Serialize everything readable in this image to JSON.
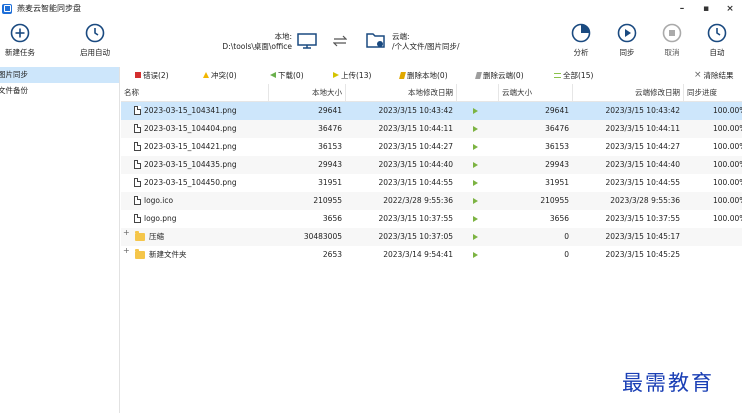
{
  "window": {
    "title": "燕麦云智能同步盘",
    "minimize": "–",
    "maximize": "▪",
    "close": "×"
  },
  "toolbar": {
    "new_task": "新建任务",
    "auto_start": "启用自动",
    "local_label": "本地:",
    "local_path": "D:\\tools\\桌面\\office",
    "cloud_label": "云端:",
    "cloud_path": "/个人文件/图片同步/",
    "analyze": "分析",
    "sync": "同步",
    "cancel": "取消",
    "auto": "自动"
  },
  "sidebar": {
    "items": [
      {
        "label": "图片同步"
      },
      {
        "label": "文件备份"
      }
    ]
  },
  "filters": {
    "error": "错误(2)",
    "conflict": "冲突(0)",
    "download": "下载(0)",
    "upload": "上传(13)",
    "delete_local": "删除本地(0)",
    "delete_cloud": "删除云端(0)",
    "all": "全部(15)",
    "clear": "清除结果",
    "colors": {
      "error": "#d32f2f",
      "conflict": "#f2b600",
      "download": "#6ab04c",
      "upload": "#d4c400",
      "delete_local": "#e0a800",
      "delete_cloud": "#9e9e9e"
    }
  },
  "table": {
    "headers": {
      "name": "名称",
      "local_size": "本地大小",
      "local_modified": "本地修改日期",
      "cloud_size": "云端大小",
      "cloud_modified": "云端修改日期",
      "progress": "同步进度"
    },
    "rows": [
      {
        "type": "file",
        "name": "2023-03-15_104341.png",
        "local_size": "29641",
        "local_modified": "2023/3/15 10:43:42",
        "action": "upload",
        "cloud_size": "29641",
        "cloud_modified": "2023/3/15 10:43:42",
        "progress": "100.00%"
      },
      {
        "type": "file",
        "name": "2023-03-15_104404.png",
        "local_size": "36476",
        "local_modified": "2023/3/15 10:44:11",
        "action": "upload",
        "cloud_size": "36476",
        "cloud_modified": "2023/3/15 10:44:11",
        "progress": "100.00%"
      },
      {
        "type": "file",
        "name": "2023-03-15_104421.png",
        "local_size": "36153",
        "local_modified": "2023/3/15 10:44:27",
        "action": "upload",
        "cloud_size": "36153",
        "cloud_modified": "2023/3/15 10:44:27",
        "progress": "100.00%"
      },
      {
        "type": "file",
        "name": "2023-03-15_104435.png",
        "local_size": "29943",
        "local_modified": "2023/3/15 10:44:40",
        "action": "upload",
        "cloud_size": "29943",
        "cloud_modified": "2023/3/15 10:44:40",
        "progress": "100.00%"
      },
      {
        "type": "file",
        "name": "2023-03-15_104450.png",
        "local_size": "31951",
        "local_modified": "2023/3/15 10:44:55",
        "action": "upload",
        "cloud_size": "31951",
        "cloud_modified": "2023/3/15 10:44:55",
        "progress": "100.00%"
      },
      {
        "type": "file",
        "name": "logo.ico",
        "local_size": "210955",
        "local_modified": "2022/3/28 9:55:36",
        "action": "upload",
        "cloud_size": "210955",
        "cloud_modified": "2023/3/28 9:55:36",
        "progress": "100.00%"
      },
      {
        "type": "file",
        "name": "logo.png",
        "local_size": "3656",
        "local_modified": "2023/3/15 10:37:55",
        "action": "upload",
        "cloud_size": "3656",
        "cloud_modified": "2023/3/15 10:37:55",
        "progress": "100.00%"
      },
      {
        "type": "folder",
        "name": "压缩",
        "local_size": "30483005",
        "local_modified": "2023/3/15 10:37:05",
        "action": "upload",
        "cloud_size": "0",
        "cloud_modified": "2023/3/15 10:45:17",
        "progress": ""
      },
      {
        "type": "folder",
        "name": "新建文件夹",
        "local_size": "2653",
        "local_modified": "2023/3/14 9:54:41",
        "action": "upload",
        "cloud_size": "0",
        "cloud_modified": "2023/3/15 10:45:25",
        "progress": ""
      }
    ]
  },
  "watermark": "最需教育"
}
